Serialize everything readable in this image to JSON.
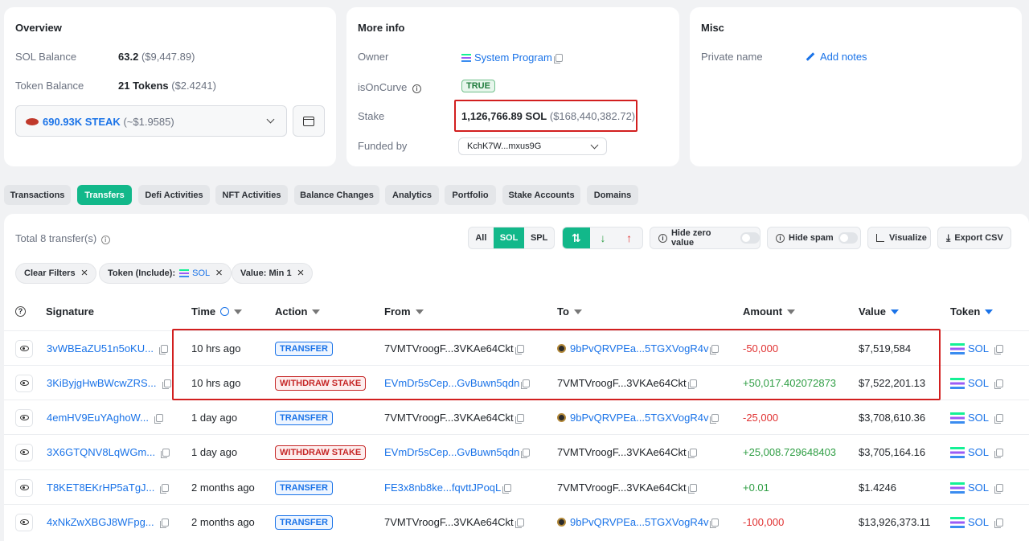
{
  "overview": {
    "title": "Overview",
    "sol_balance_label": "SOL Balance",
    "sol_balance_value": "63.2",
    "sol_balance_usd": "($9,447.89)",
    "token_balance_label": "Token Balance",
    "token_balance_value": "21 Tokens",
    "token_balance_usd": "($2.4241)",
    "token_select_value": "690.93K STEAK",
    "token_select_usd": "(~$1.9585)"
  },
  "more_info": {
    "title": "More info",
    "owner_label": "Owner",
    "owner_value": "System Program",
    "oncurve_label": "isOnCurve",
    "oncurve_value": "TRUE",
    "stake_label": "Stake",
    "stake_value": "1,126,766.89 SOL",
    "stake_usd": "($168,440,382.72)",
    "funded_label": "Funded by",
    "funded_value": "KchK7W...mxus9G"
  },
  "misc": {
    "title": "Misc",
    "private_name_label": "Private name",
    "add_notes": "Add notes"
  },
  "tabs": [
    "Transactions",
    "Transfers",
    "Defi Activities",
    "NFT Activities",
    "Balance Changes",
    "Analytics",
    "Portfolio",
    "Stake Accounts",
    "Domains"
  ],
  "active_tab": "Transfers",
  "transfers": {
    "total_label": "Total 8 transfer(s)",
    "type_filter": [
      "All",
      "SOL",
      "SPL"
    ],
    "hide_zero": "Hide zero value",
    "hide_spam": "Hide spam",
    "visualize": "Visualize",
    "export": "Export CSV",
    "chips": {
      "clear": "Clear Filters",
      "token_prefix": "Token (Include):",
      "token_value": "SOL",
      "value": "Value: Min 1"
    },
    "headers": {
      "signature": "Signature",
      "time": "Time",
      "action": "Action",
      "from": "From",
      "to": "To",
      "amount": "Amount",
      "value": "Value",
      "token": "Token"
    },
    "rows": [
      {
        "sig": "3vWBEaZU51n5oKU...",
        "time": "10 hrs ago",
        "action": "TRANSFER",
        "from": "7VMTVroogF...3VKAe64Ckt",
        "to": "9bPvQRVPEa...5TGXVogR4v",
        "amount": "-50,000",
        "value": "$7,519,584",
        "token": "SOL"
      },
      {
        "sig": "3KiByjgHwBWcwZRS...",
        "time": "10 hrs ago",
        "action": "WITHDRAW STAKE",
        "from": "EVmDr5sCep...GvBuwn5qdn",
        "to": "7VMTVroogF...3VKAe64Ckt",
        "amount": "+50,017.402072873",
        "value": "$7,522,201.13",
        "token": "SOL"
      },
      {
        "sig": "4emHV9EuYAghoW...",
        "time": "1 day ago",
        "action": "TRANSFER",
        "from": "7VMTVroogF...3VKAe64Ckt",
        "to": "9bPvQRVPEa...5TGXVogR4v",
        "amount": "-25,000",
        "value": "$3,708,610.36",
        "token": "SOL"
      },
      {
        "sig": "3X6GTQNV8LqWGm...",
        "time": "1 day ago",
        "action": "WITHDRAW STAKE",
        "from": "EVmDr5sCep...GvBuwn5qdn",
        "to": "7VMTVroogF...3VKAe64Ckt",
        "amount": "+25,008.729648403",
        "value": "$3,705,164.16",
        "token": "SOL"
      },
      {
        "sig": "T8KET8EKrHP5aTgJ...",
        "time": "2 months ago",
        "action": "TRANSFER",
        "from": "FE3x8nb8ke...fqvttJPoqL",
        "to": "7VMTVroogF...3VKAe64Ckt",
        "amount": "+0.01",
        "value": "$1.4246",
        "token": "SOL"
      },
      {
        "sig": "4xNkZwXBGJ8WFpg...",
        "time": "2 months ago",
        "action": "TRANSFER",
        "from": "7VMTVroogF...3VKAe64Ckt",
        "to": "9bPvQRVPEa...5TGXVogR4v",
        "amount": "-100,000",
        "value": "$13,926,373.11",
        "token": "SOL"
      }
    ]
  }
}
